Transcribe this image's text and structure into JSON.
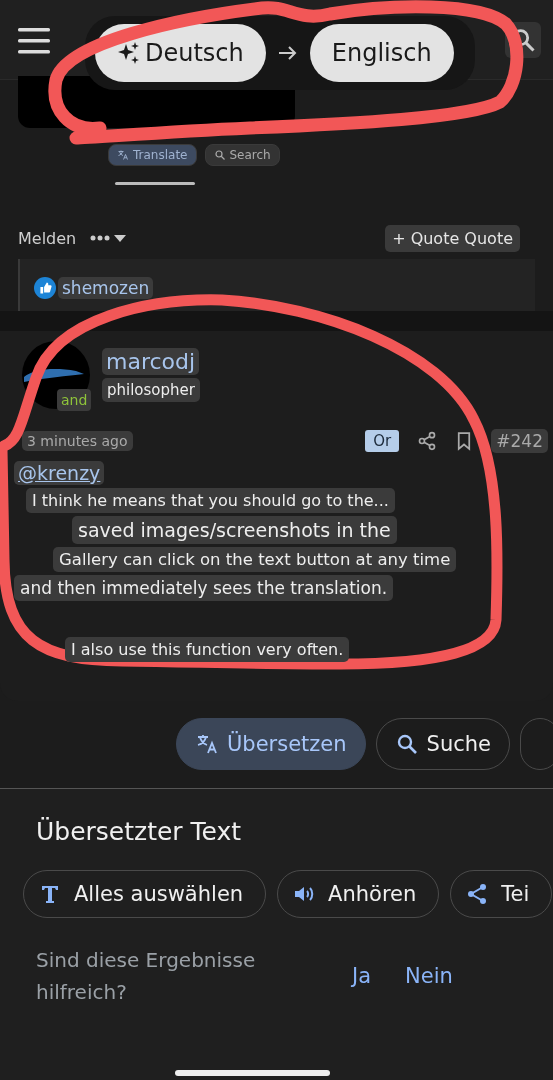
{
  "lens_bar": {
    "source_language": "Deutsch",
    "target_language": "Englisch"
  },
  "page": {
    "chips": [
      {
        "label": "Translate",
        "kind": "translate",
        "selected": true
      },
      {
        "label": "Search",
        "kind": "search",
        "selected": false
      }
    ],
    "report": "Melden",
    "quote_button": "+ Quote Quote",
    "reactions": [
      {
        "user": "shemozen"
      }
    ],
    "post": {
      "author": "marcodj",
      "rank": "philosopher",
      "avatar_badge": "and",
      "time": "3 minutes ago",
      "label": "Or",
      "number": "#242",
      "mention": "@krenzy",
      "lines": [
        "I think he means that you should go to the...",
        "saved images/screenshots in the",
        "Gallery can click on the text button at any time",
        "and then immediately sees the translation.",
        "I also use this function very often."
      ]
    }
  },
  "lens_actions": [
    {
      "kind": "translate",
      "label": "Übersetzen",
      "selected": true
    },
    {
      "kind": "search",
      "label": "Suche",
      "selected": false
    },
    {
      "kind": "partial",
      "selected": false
    }
  ],
  "sheet": {
    "title": "Übersetzter Text",
    "actions": [
      {
        "kind": "select",
        "label": "Alles auswählen"
      },
      {
        "kind": "listen",
        "label": "Anhören"
      },
      {
        "kind": "share",
        "label": "Tei"
      }
    ],
    "feedback": {
      "question": "Sind diese Ergebnisse hilfreich?",
      "yes": "Ja",
      "no": "Nein"
    }
  }
}
